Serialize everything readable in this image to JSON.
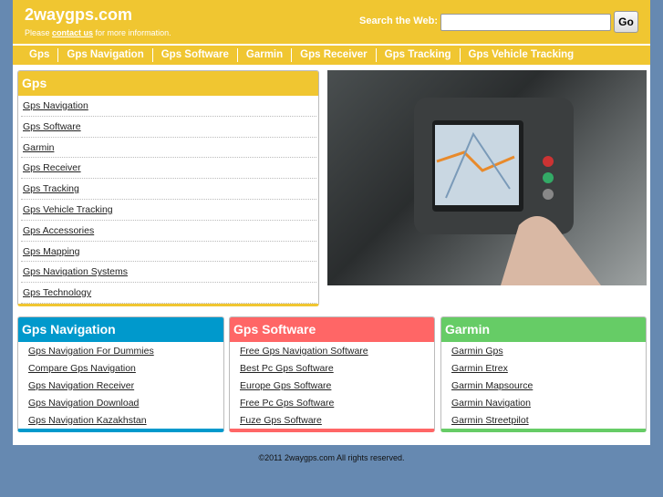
{
  "header": {
    "logo": "2waygps.com",
    "tagline_pre": "Please ",
    "tagline_link": "contact us",
    "tagline_post": " for more information.",
    "search_label": "Search the Web:",
    "search_value": "",
    "go": "Go"
  },
  "nav": [
    "Gps",
    "Gps Navigation",
    "Gps Software",
    "Garmin",
    "Gps Receiver",
    "Gps Tracking",
    "Gps Vehicle Tracking"
  ],
  "gps_box": {
    "title": "Gps",
    "links": [
      "Gps Navigation",
      "Gps Software",
      "Garmin",
      "Gps Receiver",
      "Gps Tracking",
      "Gps Vehicle Tracking",
      "Gps Accessories",
      "Gps Mapping",
      "Gps Navigation Systems",
      "Gps Technology"
    ]
  },
  "boxes": [
    {
      "title": "Gps Navigation",
      "color": "#0099cc",
      "links": [
        "Gps Navigation For Dummies",
        "Compare Gps Navigation",
        "Gps Navigation Receiver",
        "Gps Navigation Download",
        "Gps Navigation Kazakhstan"
      ]
    },
    {
      "title": "Gps Software",
      "color": "#ff6666",
      "links": [
        "Free Gps Navigation Software",
        "Best Pc Gps Software",
        "Europe Gps Software",
        "Free Pc Gps Software",
        "Fuze Gps Software"
      ]
    },
    {
      "title": "Garmin",
      "color": "#66cc66",
      "links": [
        "Garmin Gps",
        "Garmin Etrex",
        "Garmin Mapsource",
        "Garmin Navigation",
        "Garmin Streetpilot"
      ]
    }
  ],
  "footer": "©2011 2waygps.com All rights reserved."
}
